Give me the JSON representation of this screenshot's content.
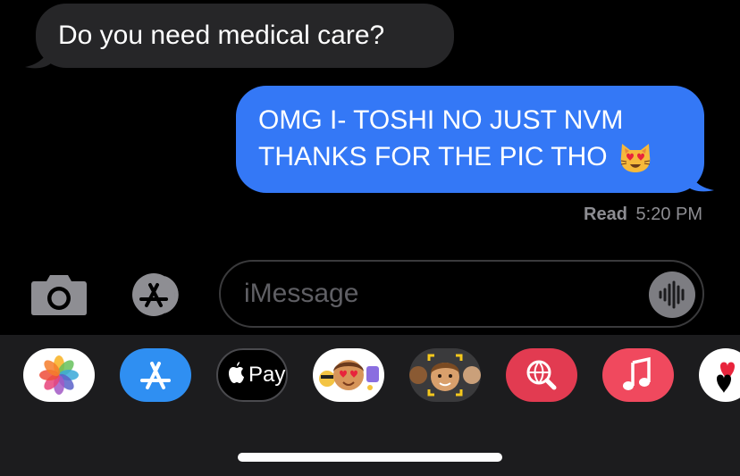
{
  "conversation": {
    "incoming_message": "Do you need medical care?",
    "outgoing_message": {
      "line1": "OMG I- TOSHI NO JUST NVM",
      "line2": "THANKS FOR THE PIC THO",
      "emoji": "heart-eyes-cat-emoji"
    },
    "read_receipt": {
      "label": "Read",
      "time": "5:20 PM"
    }
  },
  "composer": {
    "placeholder": "iMessage"
  },
  "app_drawer": {
    "apps": [
      {
        "name": "Photos",
        "icon": "photos-icon"
      },
      {
        "name": "App Store",
        "icon": "app-store-icon"
      },
      {
        "name": "Apple Pay",
        "icon": "apple-pay-icon",
        "label": "Pay"
      },
      {
        "name": "Memoji Stickers",
        "icon": "memoji-stickers-icon"
      },
      {
        "name": "Memoji Camera",
        "icon": "memoji-camera-icon"
      },
      {
        "name": "Images Search",
        "icon": "images-search-icon"
      },
      {
        "name": "Music",
        "icon": "music-icon"
      },
      {
        "name": "Digital Touch",
        "icon": "digital-touch-icon"
      }
    ]
  },
  "colors": {
    "incoming_bubble": "#262628",
    "outgoing_bubble": "#3478f6",
    "drawer_background": "#1c1c1e",
    "muted_text": "#8d8d92"
  }
}
